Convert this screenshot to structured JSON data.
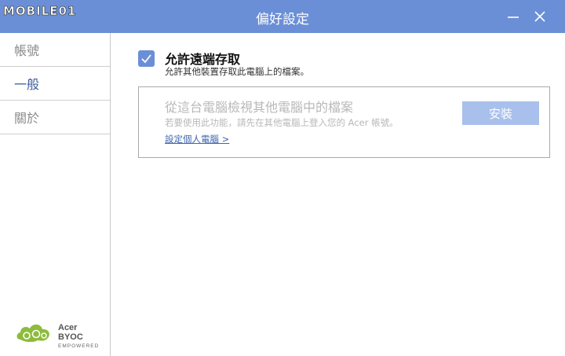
{
  "titlebar": {
    "brand": "MOBILE01",
    "title": "偏好設定",
    "colors": {
      "bar": "#6b8fd6"
    }
  },
  "sidebar": {
    "items": [
      {
        "label": "帳號",
        "active": false
      },
      {
        "label": "一般",
        "active": true
      },
      {
        "label": "關於",
        "active": false
      }
    ],
    "logo": {
      "name": "Acer BYOC",
      "sub": "EMPOWERED"
    }
  },
  "main": {
    "remote_access": {
      "checked": true,
      "title": "允許遠端存取",
      "description": "允許其他裝置存取此電腦上的檔案。"
    },
    "browse_panel": {
      "title": "從這台電腦檢視其他電腦中的檔案",
      "description": "若要使用此功能，請先在其他電腦上登入您的 Acer 帳號。",
      "link": "設定個人電腦 >",
      "install_label": "安裝"
    }
  }
}
